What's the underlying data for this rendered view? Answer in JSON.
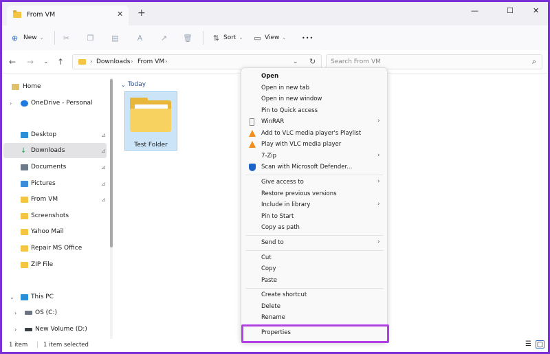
{
  "window": {
    "tab_title": "From VM",
    "tab_close": "✕",
    "new_tab": "+",
    "minimize": "—",
    "maximize": "☐",
    "close": "✕"
  },
  "toolbar": {
    "new_label": "New",
    "sort_label": "Sort",
    "view_label": "View",
    "more": "•••"
  },
  "address": {
    "crumbs": [
      "Downloads",
      "From VM"
    ],
    "separator": "›",
    "search_placeholder": "Search From VM"
  },
  "sidebar": {
    "quick": [
      {
        "label": "Home",
        "icon": "home-icon",
        "color": "#e0c16a"
      },
      {
        "label": "OneDrive - Personal",
        "icon": "cloud-icon",
        "color": "#1f7ae0"
      }
    ],
    "pinned": [
      {
        "label": "Desktop",
        "icon": "desktop-icon",
        "color": "#2a8fd6",
        "pin": "⊿"
      },
      {
        "label": "Downloads",
        "icon": "download-icon",
        "color": "#2aa05a",
        "pin": "⊿"
      },
      {
        "label": "Documents",
        "icon": "documents-icon",
        "color": "#6c7a89",
        "pin": "⊿"
      },
      {
        "label": "Pictures",
        "icon": "pictures-icon",
        "color": "#3c8dd9",
        "pin": "⊿"
      },
      {
        "label": "From VM",
        "icon": "folder-icon",
        "color": "#f4c542",
        "pin": "⊿"
      },
      {
        "label": "Screenshots",
        "icon": "folder-icon",
        "color": "#f4c542"
      },
      {
        "label": "Yahoo Mail",
        "icon": "folder-icon",
        "color": "#f4c542"
      },
      {
        "label": "Repair MS Office",
        "icon": "folder-icon",
        "color": "#f4c542"
      },
      {
        "label": "ZIP File",
        "icon": "folder-icon",
        "color": "#f4c542"
      }
    ],
    "this_pc": "This PC",
    "drives": [
      {
        "label": "OS (C:)",
        "icon": "drive-icon"
      },
      {
        "label": "New Volume (D:)",
        "icon": "drive-icon"
      }
    ]
  },
  "content": {
    "group": "Today",
    "item_label": "Test Folder"
  },
  "status": {
    "count": "1 item",
    "selected": "1 item selected"
  },
  "context_menu": {
    "group1": [
      {
        "label": "Open",
        "bold": true
      },
      {
        "label": "Open in new tab"
      },
      {
        "label": "Open in new window"
      },
      {
        "label": "Pin to Quick access"
      },
      {
        "label": "WinRAR",
        "arrow": "›",
        "icon": "winrar-icon"
      },
      {
        "label": "Add to VLC media player's Playlist",
        "icon": "vlc-icon"
      },
      {
        "label": "Play with VLC media player",
        "icon": "vlc-icon"
      },
      {
        "label": "7-Zip",
        "arrow": "›"
      },
      {
        "label": "Scan with Microsoft Defender...",
        "icon": "defender-icon"
      }
    ],
    "group2": [
      {
        "label": "Give access to",
        "arrow": "›"
      },
      {
        "label": "Restore previous versions"
      },
      {
        "label": "Include in library",
        "arrow": "›"
      },
      {
        "label": "Pin to Start"
      },
      {
        "label": "Copy as path"
      }
    ],
    "group3": [
      {
        "label": "Send to",
        "arrow": "›"
      }
    ],
    "group4": [
      {
        "label": "Cut"
      },
      {
        "label": "Copy"
      },
      {
        "label": "Paste"
      }
    ],
    "group5": [
      {
        "label": "Create shortcut"
      },
      {
        "label": "Delete"
      },
      {
        "label": "Rename"
      }
    ],
    "group6": [
      {
        "label": "Properties"
      }
    ],
    "highlight_color": "#b23ee6"
  }
}
